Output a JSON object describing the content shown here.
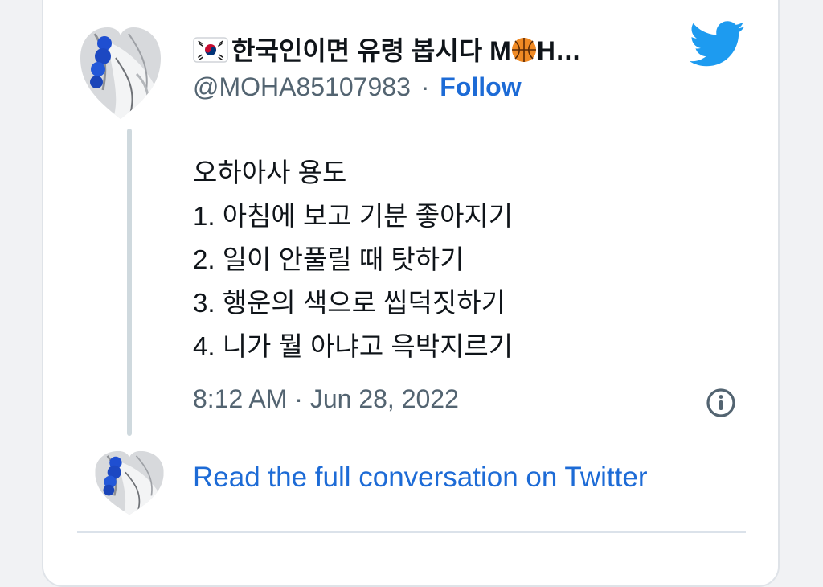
{
  "tweet": {
    "author_name": "한국인이면 유령 봅시다 M",
    "author_name_tail": "H…",
    "handle": "@MOHA85107983",
    "separator": "·",
    "follow_label": "Follow",
    "text_lines": [
      "오하아사 용도",
      "1. 아침에 보고 기분 좋아지기",
      "2. 일이 안풀릴 때 탓하기",
      "3. 행운의 색으로 씹덕짓하기",
      "4. 니가 뭘 아냐고 윽박지르기"
    ],
    "timestamp": "8:12 AM · Jun 28, 2022"
  },
  "footer": {
    "read_full_label": "Read the full conversation on Twitter"
  },
  "icons": {
    "brand": "twitter-bird-icon",
    "flag": "south-korea-flag-icon",
    "ball": "basketball-icon",
    "info": "info-circle-icon"
  },
  "colors": {
    "link": "#1d6bd6",
    "twitter_blue": "#1d9bf0",
    "text": "#0f1419",
    "muted": "#536471"
  }
}
